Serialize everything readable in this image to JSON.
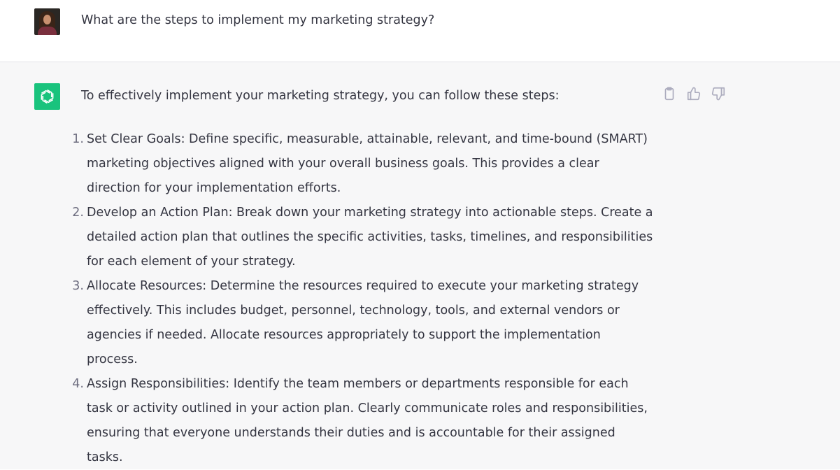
{
  "user_message": {
    "text": "What are the steps to implement my marketing strategy?"
  },
  "assistant_message": {
    "intro": "To effectively implement your marketing strategy, you can follow these steps:",
    "steps": [
      {
        "number": "1.",
        "lines": [
          "Set Clear Goals: Define specific, measurable, attainable, relevant, and time-bound (SMART)",
          "marketing objectives aligned with your overall business goals. This provides a clear",
          "direction for your implementation efforts."
        ]
      },
      {
        "number": "2.",
        "lines": [
          "Develop an Action Plan: Break down your marketing strategy into actionable steps. Create a",
          "detailed action plan that outlines the specific activities, tasks, timelines, and responsibilities",
          "for each element of your strategy."
        ]
      },
      {
        "number": "3.",
        "lines": [
          "Allocate Resources: Determine the resources required to execute your marketing strategy",
          "effectively. This includes budget, personnel, technology, tools, and external vendors or",
          "agencies if needed. Allocate resources appropriately to support the implementation",
          "process."
        ]
      },
      {
        "number": "4.",
        "lines": [
          "Assign Responsibilities: Identify the team members or departments responsible for each",
          "task or activity outlined in your action plan. Clearly communicate roles and responsibilities,",
          "ensuring that everyone understands their duties and is accountable for their assigned",
          "tasks."
        ]
      }
    ]
  },
  "actions": {
    "icons": [
      "clipboard-icon",
      "thumbs-up-icon",
      "thumbs-down-icon"
    ]
  },
  "colors": {
    "text": "#343541",
    "assistant_bg": "#f7f7f8",
    "assistant_avatar": "#19c37d",
    "icon_gray": "#acacbe"
  }
}
